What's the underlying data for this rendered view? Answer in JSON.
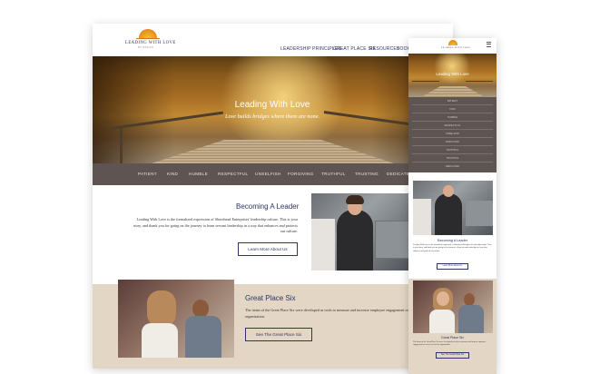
{
  "brand": {
    "logo_line1": "LEADING WITH LOVE",
    "logo_line2": "BY DESIGN",
    "colors": {
      "navy": "#2c3567",
      "brown_bar": "#5e5552",
      "tan": "#e3d6c5"
    }
  },
  "nav": {
    "items": [
      "LEADERSHIP PRINCIPLES",
      "GREAT PLACE SIX",
      "RESOURCES",
      "BOOKS"
    ],
    "dropdown_icon": "chevron-down-icon"
  },
  "hero": {
    "title": "Leading With Love",
    "subtitle": "Love builds bridges where there are none."
  },
  "virtues": [
    "PATIENT",
    "KIND",
    "HUMBLE",
    "RESPECTFUL",
    "UNSELFISH",
    "FORGIVING",
    "TRUTHFUL",
    "TRUSTING",
    "DEDICATED"
  ],
  "leader": {
    "title": "Becoming A Leader",
    "body": "Leading With Love is the formalized expression of Shorehead Enterprises' leadership culture. This is your story, and thank you for going on the journey to learn servant leadership in a way that enhances and protects our culture.",
    "button": "Learn More About Us"
  },
  "great_six": {
    "title": "Great Place Six",
    "body": "The items of the Great Place Six were developed as tools to measure and increase employee engagement on every level of our organization.",
    "button": "See The Great Place Six"
  },
  "mobile": {
    "menu_icon": "hamburger-icon",
    "hero_title": "Leading With Love",
    "virtues": [
      "PATIENT",
      "KIND",
      "HUMBLE",
      "RESPECTFUL",
      "UNSELFISH",
      "FORGIVING",
      "TRUTHFUL",
      "TRUSTING",
      "DEDICATED"
    ],
    "leader_title": "Becoming A Leader",
    "leader_body": "Leading With Love is the formalized expression of Shorehead Enterprises' leadership culture. This is your story, and thank you for going on the journey to learn servant leadership in a way that enhances and protects our culture.",
    "leader_button": "Learn More About Us",
    "six_title": "Great Place Six",
    "six_body": "The items of the Great Place Six were developed as tools to measure and increase employee engagement on every level of our organization.",
    "six_button": "See The Great Place Six"
  }
}
